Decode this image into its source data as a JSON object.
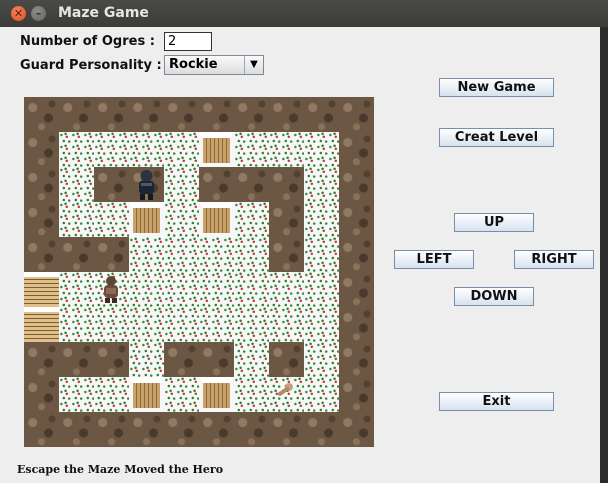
{
  "window": {
    "title": "Maze Game"
  },
  "controls": {
    "ogres_label": "Number of Ogres :",
    "ogres_value": "2",
    "personality_label": "Guard Personality :",
    "personality_value": "Rockie"
  },
  "buttons": {
    "new_game": "New Game",
    "create_level": "Creat Level",
    "up": "UP",
    "left": "LEFT",
    "right": "RIGHT",
    "down": "DOWN",
    "exit": "Exit"
  },
  "status": "Escape the Maze Moved the Hero",
  "maze": {
    "rows": [
      "XXXXXXXXXX",
      "X    I   X",
      "X XX XXX X",
      "X  I I X X",
      "XXX    X X",
      "D        X",
      "D        X",
      "XXX XX X X",
      "X  I I   X",
      "XXXXXXXXXX"
    ],
    "guard": {
      "row": 2,
      "col": 3
    },
    "hero": {
      "row": 5,
      "col": 2
    },
    "key": {
      "row": 8,
      "col": 7
    }
  }
}
